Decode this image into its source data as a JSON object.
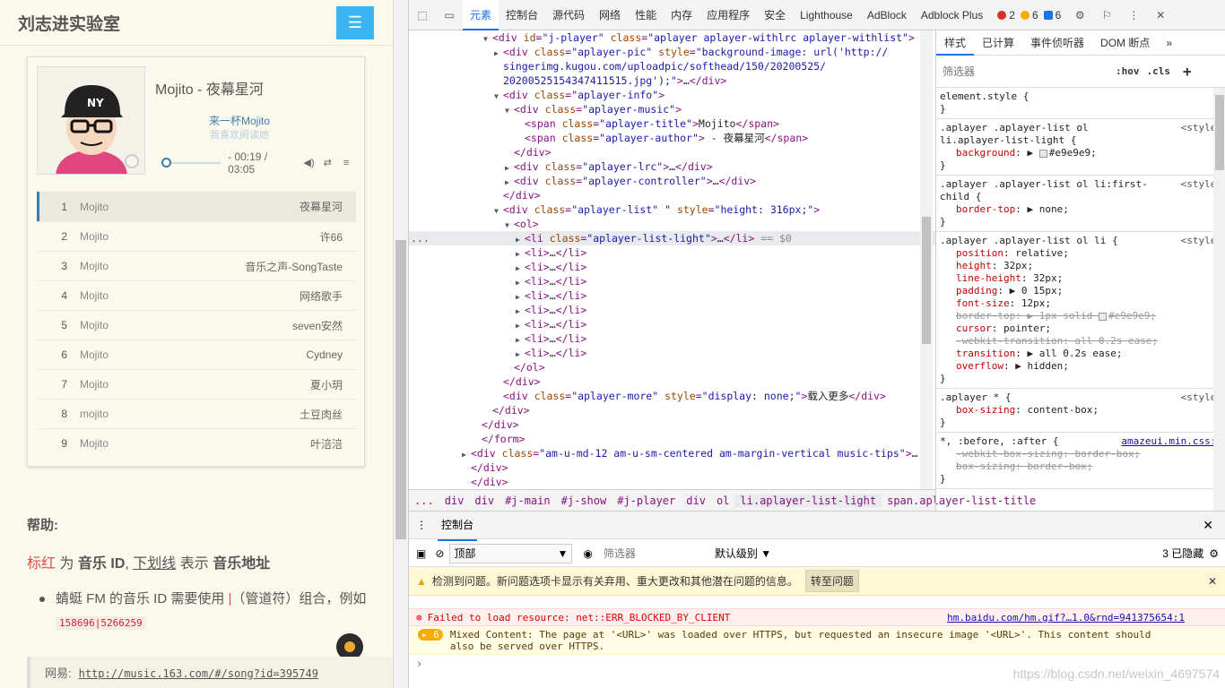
{
  "page": {
    "site_title": "刘志进实验室",
    "menu_icon": "hamburger-icon",
    "player": {
      "song_title": "Mojito - 夜幕星河",
      "lrc_current": "来一杯Mojito",
      "lrc_next": "我喜欢阅读她",
      "progress": 0.1,
      "time": "- 00:19 / 03:05",
      "playlist": [
        {
          "index": "1",
          "title": "Mojito",
          "author": "夜幕星河"
        },
        {
          "index": "2",
          "title": "Mojito",
          "author": "许66"
        },
        {
          "index": "3",
          "title": "Mojito",
          "author": "音乐之声-SongTaste"
        },
        {
          "index": "4",
          "title": "Mojito",
          "author": "网络歌手"
        },
        {
          "index": "5",
          "title": "Mojito",
          "author": "seven安然"
        },
        {
          "index": "6",
          "title": "Mojito",
          "author": "Cydney"
        },
        {
          "index": "7",
          "title": "Mojito",
          "author": "夏小玥"
        },
        {
          "index": "8",
          "title": "mojito",
          "author": "土豆肉丝"
        },
        {
          "index": "9",
          "title": "Mojito",
          "author": "叶涪涪"
        }
      ]
    },
    "help": {
      "heading": "帮助:",
      "red_word": "标红",
      "t1": " 为 ",
      "music_id": "音乐 ID",
      "t2": ", ",
      "underline": "下划线",
      "t3": " 表示 ",
      "music_url": "音乐地址",
      "bullet_a": "蜻蜓 FM 的音乐 ID 需要使用 ",
      "pipe": "|",
      "bullet_b": "（管道符）组合，例如 ",
      "example": "158696|5266259",
      "quote_label": "网易:",
      "quote_url": "http://music.163.com/#/song?id=395749"
    }
  },
  "devtools": {
    "tabs": [
      "元素",
      "控制台",
      "源代码",
      "网络",
      "性能",
      "内存",
      "应用程序",
      "安全",
      "Lighthouse",
      "AdBlock",
      "Adblock Plus"
    ],
    "active_tab": "元素",
    "errors": "2",
    "warnings": "6",
    "infos": "6",
    "dom_lines": [
      {
        "indent": 95,
        "tri": "▼",
        "html": "<span class=tg>&lt;div</span> <span class=an>id</span>=<span class=av>\"j-player\"</span> <span class=an>class</span>=<span class=av>\"aplayer aplayer-withlrc aplayer-withlist\"</span><span class=tg>&gt;</span>"
      },
      {
        "indent": 107,
        "tri": "▶",
        "html": "<span class=tg>&lt;div</span> <span class=an>class</span>=<span class=av>\"aplayer-pic\"</span> <span class=an>style</span>=<span class=av>\"background-image: url('http://</span>"
      },
      {
        "indent": 0,
        "tri": "",
        "html": "<span class=av>singerimg.kugou.com/uploadpic/softhead/150/20200525/</span>"
      },
      {
        "indent": 0,
        "tri": "",
        "html": "<span class=av>20200525154347411515.jpg');\"</span><span class=tg>&gt;</span><span class=tx>…</span><span class=tg>&lt;/div&gt;</span>"
      },
      {
        "indent": 107,
        "tri": "▼",
        "html": "<span class=tg>&lt;div</span> <span class=an>class</span>=<span class=av>\"aplayer-info\"</span><span class=tg>&gt;</span>"
      },
      {
        "indent": 119,
        "tri": "▼",
        "html": "<span class=tg>&lt;div</span> <span class=an>class</span>=<span class=av>\"aplayer-music\"</span><span class=tg>&gt;</span>"
      },
      {
        "indent": 131,
        "tri": "",
        "html": "<span class=tg>&lt;span</span> <span class=an>class</span>=<span class=av>\"aplayer-title\"</span><span class=tg>&gt;</span><span class=tx>Mojito</span><span class=tg>&lt;/span&gt;</span>"
      },
      {
        "indent": 131,
        "tri": "",
        "html": "<span class=tg>&lt;span</span> <span class=an>class</span>=<span class=av>\"aplayer-author\"</span><span class=tg>&gt;</span><span class=tx> - 夜幕星河</span><span class=tg>&lt;/span&gt;</span>"
      },
      {
        "indent": 119,
        "tri": "",
        "html": "<span class=tg>&lt;/div&gt;</span>"
      },
      {
        "indent": 119,
        "tri": "▶",
        "html": "<span class=tg>&lt;div</span> <span class=an>class</span>=<span class=av>\"aplayer-lrc\"</span><span class=tg>&gt;</span><span class=tx>…</span><span class=tg>&lt;/div&gt;</span>"
      },
      {
        "indent": 119,
        "tri": "▶",
        "html": "<span class=tg>&lt;div</span> <span class=an>class</span>=<span class=av>\"aplayer-controller\"</span><span class=tg>&gt;</span><span class=tx>…</span><span class=tg>&lt;/div&gt;</span>"
      },
      {
        "indent": 107,
        "tri": "",
        "html": "<span class=tg>&lt;/div&gt;</span>"
      },
      {
        "indent": 107,
        "tri": "▼",
        "html": "<span class=tg>&lt;div</span> <span class=an>class</span>=<span class=av>\"aplayer-list\"</span> <span class=tx>\"</span> <span class=an>style</span>=<span class=av>\"height: 316px;\"</span><span class=tg>&gt;</span>"
      },
      {
        "indent": 119,
        "tri": "▼",
        "html": "<span class=tg>&lt;ol&gt;</span>"
      },
      {
        "indent": 131,
        "tri": "▶",
        "sel": true,
        "html": "<span class=tg>&lt;li</span> <span class=an>class</span>=<span class=av>\"aplayer-list-light\"</span><span class=tg>&gt;</span><span class=tx>…</span><span class=tg>&lt;/li&gt;</span> <span class=cm>== $0</span>"
      },
      {
        "indent": 131,
        "tri": "▶",
        "html": "<span class=tg>&lt;li&gt;</span><span class=tx>…</span><span class=tg>&lt;/li&gt;</span>"
      },
      {
        "indent": 131,
        "tri": "▶",
        "html": "<span class=tg>&lt;li&gt;</span><span class=tx>…</span><span class=tg>&lt;/li&gt;</span>"
      },
      {
        "indent": 131,
        "tri": "▶",
        "html": "<span class=tg>&lt;li&gt;</span><span class=tx>…</span><span class=tg>&lt;/li&gt;</span>"
      },
      {
        "indent": 131,
        "tri": "▶",
        "html": "<span class=tg>&lt;li&gt;</span><span class=tx>…</span><span class=tg>&lt;/li&gt;</span>"
      },
      {
        "indent": 131,
        "tri": "▶",
        "html": "<span class=tg>&lt;li&gt;</span><span class=tx>…</span><span class=tg>&lt;/li&gt;</span>"
      },
      {
        "indent": 131,
        "tri": "▶",
        "html": "<span class=tg>&lt;li&gt;</span><span class=tx>…</span><span class=tg>&lt;/li&gt;</span>"
      },
      {
        "indent": 131,
        "tri": "▶",
        "html": "<span class=tg>&lt;li&gt;</span><span class=tx>…</span><span class=tg>&lt;/li&gt;</span>"
      },
      {
        "indent": 131,
        "tri": "▶",
        "html": "<span class=tg>&lt;li&gt;</span><span class=tx>…</span><span class=tg>&lt;/li&gt;</span>"
      },
      {
        "indent": 119,
        "tri": "",
        "html": "<span class=tg>&lt;/ol&gt;</span>"
      },
      {
        "indent": 107,
        "tri": "",
        "html": "<span class=tg>&lt;/div&gt;</span>"
      },
      {
        "indent": 107,
        "tri": "",
        "html": "<span class=tg>&lt;div</span> <span class=an>class</span>=<span class=av>\"aplayer-more\"</span> <span class=an>style</span>=<span class=av>\"display: none;\"</span><span class=tg>&gt;</span><span class=tx>载入更多</span><span class=tg>&lt;/div&gt;</span>"
      },
      {
        "indent": 95,
        "tri": "",
        "html": "<span class=tg>&lt;/div&gt;</span>"
      },
      {
        "indent": 83,
        "tri": "",
        "html": "<span class=tg>&lt;/div&gt;</span>"
      },
      {
        "indent": 83,
        "tri": "",
        "html": "<span class=tg>&lt;/form&gt;</span>"
      },
      {
        "indent": 71,
        "tri": "▶",
        "html": "<span class=tg>&lt;div</span> <span class=an>class</span>=<span class=av>\"am-u-md-12 am-u-sm-centered am-margin-vertical music-tips\"</span><span class=tg>&gt;</span><span class=tx>…</span>"
      },
      {
        "indent": 71,
        "tri": "",
        "html": "<span class=tg>&lt;/div&gt;</span>"
      },
      {
        "indent": 71,
        "tri": "",
        "html": "<span class=tg>&lt;/div&gt;</span>"
      }
    ],
    "breadcrumbs": [
      "...",
      "div",
      "div",
      "#j-main",
      "#j-show",
      "#j-player",
      "div",
      "ol",
      "li.aplayer-list-light",
      "span.aplayer-list-title"
    ],
    "active_crumb": "li.aplayer-list-light",
    "styles_tabs": [
      "样式",
      "已计算",
      "事件侦听器",
      "DOM 断点"
    ],
    "styles_filter_placeholder": "筛选器",
    "hov": ":hov",
    "cls": ".cls",
    "rules_html": [
      "<div class=sel-t>element.style {</div><div>}</div>",
      "<span class=src>&lt;style&gt;</span><div class=sel-t>.aplayer .aplayer-list ol<br>li.aplayer-list-light {</div><div class=prop><span class=pn>background</span>: ▶ <span class=swatch style=\"background:#e9e9e9\"></span>#e9e9e9;</div><div>}</div>",
      "<span class=src>&lt;style&gt;</span><div class=sel-t>.aplayer .aplayer-list ol li:first-<br>child {</div><div class=prop><span class=pn>border-top</span>: ▶ none;</div><div>}</div>",
      "<span class=src>&lt;style&gt;</span><div class=sel-t>.aplayer .aplayer-list ol li {</div><div class=prop><span class=pn>position</span>: relative;</div><div class=prop><span class=pn>height</span>: 32px;</div><div class=prop><span class=pn>line-height</span>: 32px;</div><div class=prop><span class=pn>padding</span>: ▶ 0 15px;</div><div class=prop><span class=pn>font-size</span>: 12px;</div><div class=\"prop strike\">border-top: ▶ 1px solid <span class=swatch style=\"background:#e9e9e9\"></span>#e9e9e9;</div><div class=prop><span class=pn>cursor</span>: pointer;</div><div class=\"prop strike\">-webkit-transition: all 0.2s ease;</div><div class=prop><span class=pn>transition</span>: ▶ all 0.2s ease;</div><div class=prop><span class=pn>overflow</span>: ▶ hidden;</div><div>}</div>",
      "<span class=src>&lt;style&gt;</span><div class=sel-t>.aplayer * {</div><div class=prop><span class=pn>box-sizing</span>: content-box;</div><div>}</div>",
      "<span class=\"src link\">amazeui.min.css:1</span><div class=sel-t>*, :before, :after {</div><div class=\"prop strike\">-webkit-box-sizing: border-box;</div><div class=\"prop strike\">box-sizing: border-box;</div><div>}</div>"
    ],
    "console": {
      "drawer_tab": "控制台",
      "context": "顶部",
      "filter_placeholder": "筛选器",
      "level": "默认级别 ▼",
      "hidden": "3 已隐藏",
      "issue_text": "检测到问题。新问题选项卡显示有关弃用、重大更改和其他潜在问题的信息。",
      "issue_button": "转至问题",
      "error_text": "Failed to load resource: net::ERR_BLOCKED_BY_CLIENT",
      "error_src": "hm.baidu.com/hm.gif?…1.0&rnd=941375654:1",
      "warn_count": "6",
      "warn_text": "Mixed Content: The page at '<URL>' was loaded over HTTPS, but requested an insecure image '<URL>'. This content should also be served over HTTPS.",
      "prompt": "›"
    }
  },
  "watermark": "https://blog.csdn.net/weixin_4697574"
}
